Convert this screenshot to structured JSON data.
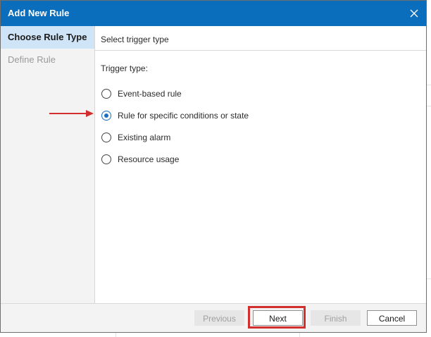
{
  "dialog": {
    "title": "Add New Rule",
    "title_bar_color": "#0a6ebd"
  },
  "sidebar": {
    "items": [
      {
        "label": "Choose Rule Type",
        "state": "active"
      },
      {
        "label": "Define Rule",
        "state": "disabled"
      }
    ]
  },
  "content": {
    "section_header": "Select trigger type",
    "field_label": "Trigger type:",
    "options": [
      {
        "label": "Event-based rule",
        "selected": false
      },
      {
        "label": "Rule for specific conditions or state",
        "selected": true
      },
      {
        "label": "Existing alarm",
        "selected": false
      },
      {
        "label": "Resource usage",
        "selected": false
      }
    ]
  },
  "footer": {
    "previous_label": "Previous",
    "next_label": "Next",
    "finish_label": "Finish",
    "cancel_label": "Cancel"
  },
  "annotations": {
    "arrow_color": "#d32f2f",
    "highlight_color": "#d32f2f"
  }
}
